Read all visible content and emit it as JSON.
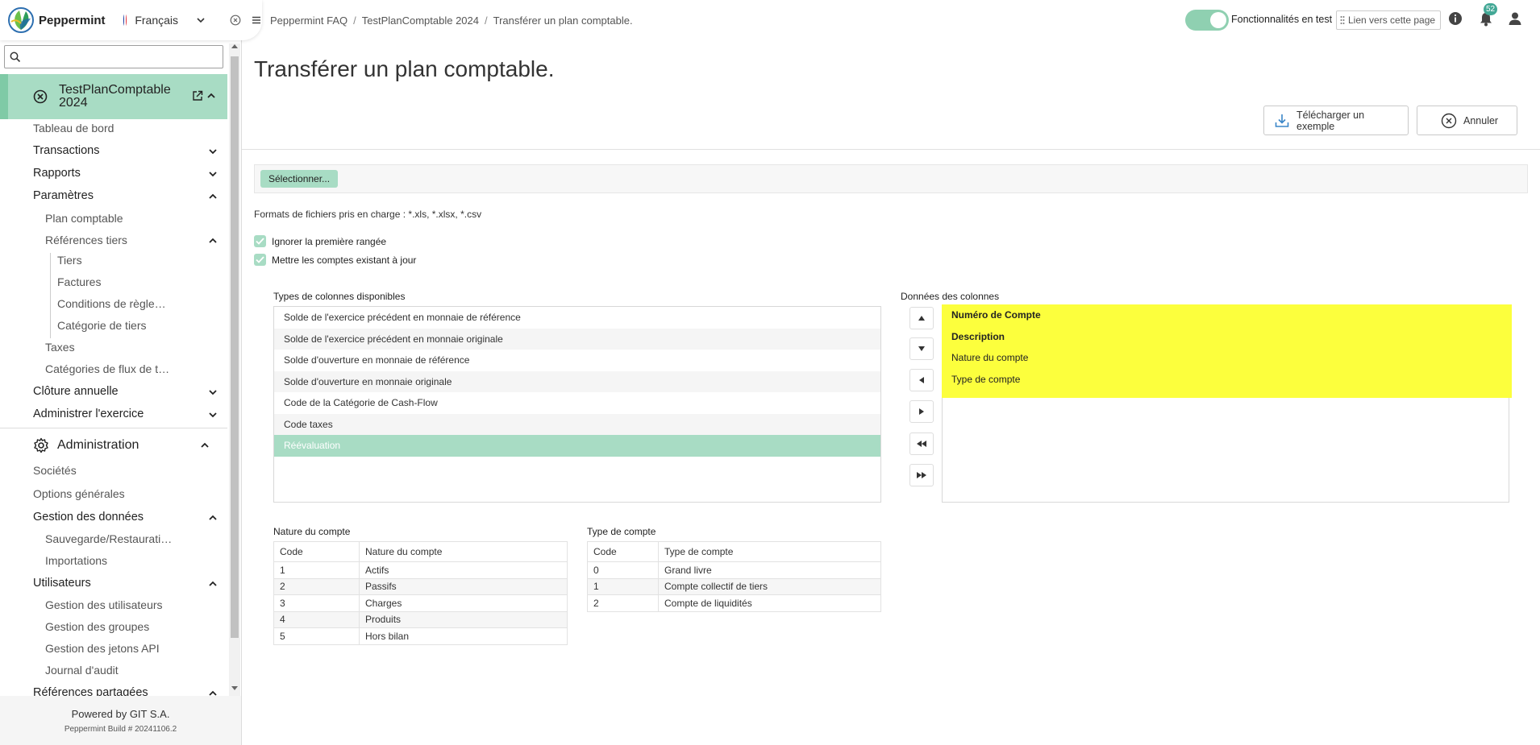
{
  "app": {
    "brand": "Peppermint",
    "language": "Français"
  },
  "sidebar": {
    "search_placeholder": "",
    "company": {
      "title_line1": "TestPlanComptable",
      "title_line2": "2024"
    },
    "items": {
      "tableau_de_bord": "Tableau de bord",
      "transactions": "Transactions",
      "rapports": "Rapports",
      "parametres": "Paramètres",
      "plan_comptable": "Plan comptable",
      "references_tiers": "Références tiers",
      "tiers": "Tiers",
      "factures": "Factures",
      "conditions": "Conditions de règle…",
      "categorie_tiers": "Catégorie de tiers",
      "taxes": "Taxes",
      "categories_flux": "Catégories de flux de t…",
      "cloture": "Clôture annuelle",
      "administrer": "Administrer l'exercice"
    },
    "admin": {
      "title": "Administration",
      "societes": "Sociétés",
      "options": "Options générales",
      "gestion_donnees": "Gestion des données",
      "sauvegarde": "Sauvegarde/Restaurati…",
      "importations": "Importations",
      "utilisateurs": "Utilisateurs",
      "gestion_utilisateurs": "Gestion des utilisateurs",
      "gestion_groupes": "Gestion des groupes",
      "gestion_jetons": "Gestion des jetons API",
      "journal": "Journal d'audit",
      "references_partagees": "Références partagées"
    },
    "footer": {
      "powered": "Powered by GIT S.A.",
      "build": "Peppermint Build # 20241106.2"
    }
  },
  "header": {
    "breadcrumb": [
      "Peppermint FAQ",
      "TestPlanComptable 2024",
      "Transférer un plan comptable."
    ],
    "features_label": "Fonctionnalités en test",
    "link_label": "Lien vers cette page",
    "notifications": "52"
  },
  "page": {
    "title": "Transférer un plan comptable.",
    "download_label": "Télécharger un exemple",
    "cancel_label": "Annuler",
    "select_label": "Sélectionner...",
    "formats": "Formats de fichiers pris en charge : *.xls, *.xlsx, *.csv",
    "ignore_first_row": "Ignorer la première rangée",
    "update_accounts": "Mettre les comptes existant à jour"
  },
  "columns": {
    "available_title": "Types de colonnes disponibles",
    "available": [
      "Solde de l'exercice précédent en monnaie de référence",
      "Solde de l'exercice précédent en monnaie originale",
      "Solde d'ouverture en monnaie de référence",
      "Solde d'ouverture en monnaie originale",
      "Code de la Catégorie de Cash-Flow",
      "Code taxes",
      "Réévaluation"
    ],
    "data_title": "Données des colonnes",
    "data": [
      "Numéro de Compte",
      "Description",
      "Nature du compte",
      "Type de compte"
    ]
  },
  "nature_table": {
    "title": "Nature du compte",
    "headers": [
      "Code",
      "Nature du compte"
    ],
    "rows": [
      [
        "1",
        "Actifs"
      ],
      [
        "2",
        "Passifs"
      ],
      [
        "3",
        "Charges"
      ],
      [
        "4",
        "Produits"
      ],
      [
        "5",
        "Hors bilan"
      ]
    ]
  },
  "type_table": {
    "title": "Type de compte",
    "headers": [
      "Code",
      "Type de compte"
    ],
    "rows": [
      [
        "0",
        "Grand livre"
      ],
      [
        "1",
        "Compte collectif de tiers"
      ],
      [
        "2",
        "Compte de liquidités"
      ]
    ]
  },
  "colors": {
    "accent": "#a8dcc4",
    "highlight": "#fcff3d",
    "badge": "#43a896"
  }
}
